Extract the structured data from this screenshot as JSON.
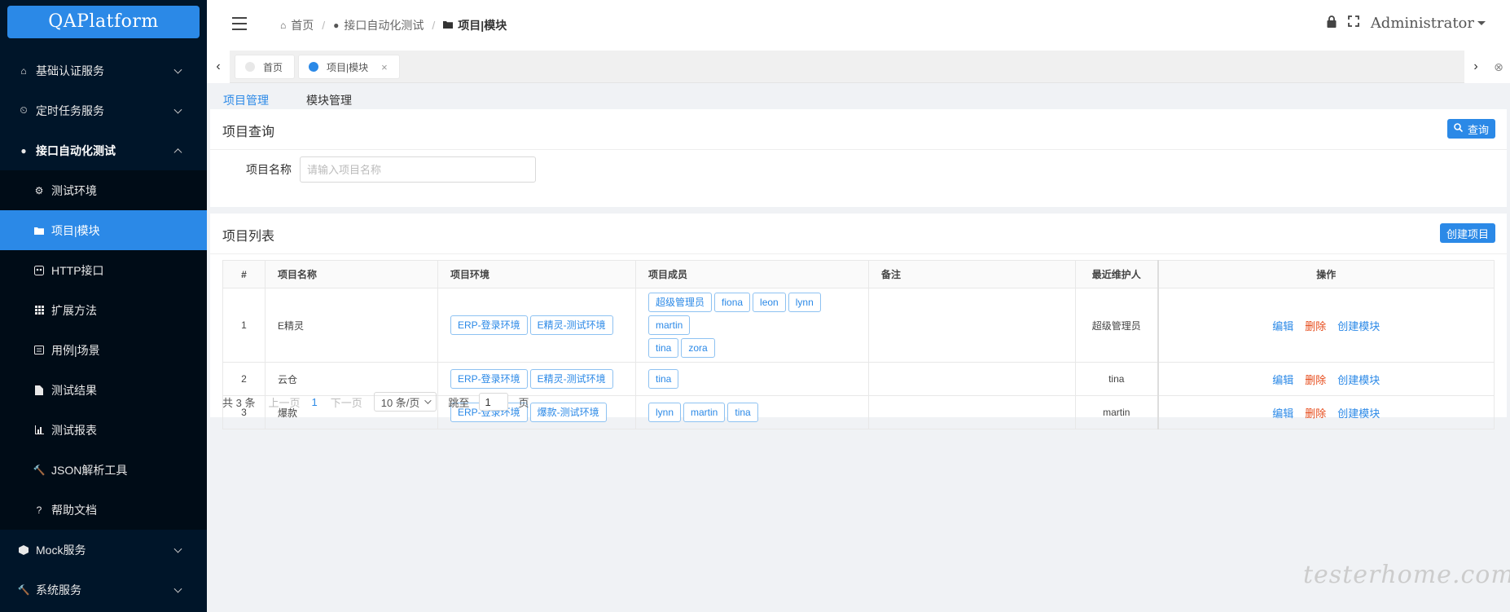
{
  "app": {
    "logo": "QAPlatform"
  },
  "sidebar": {
    "items": [
      {
        "label": "基础认证服务",
        "icon": "home-icon"
      },
      {
        "label": "定时任务服务",
        "icon": "alarm-clock-icon"
      },
      {
        "label": "接口自动化测试",
        "icon": "drop-icon",
        "children": [
          {
            "label": "测试环境",
            "icon": "gear-icon"
          },
          {
            "label": "项目|模块",
            "icon": "folder-icon"
          },
          {
            "label": "HTTP接口",
            "icon": "api-icon"
          },
          {
            "label": "扩展方法",
            "icon": "grid-icon"
          },
          {
            "label": "用例|场景",
            "icon": "case-icon"
          },
          {
            "label": "测试结果",
            "icon": "file-icon"
          },
          {
            "label": "测试报表",
            "icon": "bar-chart-icon"
          },
          {
            "label": "JSON解析工具",
            "icon": "wrench-icon"
          },
          {
            "label": "帮助文档",
            "icon": "question-icon"
          }
        ]
      },
      {
        "label": "Mock服务",
        "icon": "cube-icon"
      },
      {
        "label": "系统服务",
        "icon": "wrench-icon"
      }
    ]
  },
  "header": {
    "breadcrumb": [
      "首页",
      "接口自动化测试",
      "项目|模块"
    ],
    "user": "Administrator"
  },
  "tabs": [
    {
      "label": "首页"
    },
    {
      "label": "项目|模块",
      "close": "×"
    }
  ],
  "subtabs": [
    "项目管理",
    "模块管理"
  ],
  "query": {
    "title": "项目查询",
    "button": "查询",
    "field_label": "项目名称",
    "placeholder": "请输入项目名称"
  },
  "list": {
    "title": "项目列表",
    "create_button": "创建项目",
    "columns": [
      "#",
      "项目名称",
      "项目环境",
      "项目成员",
      "备注",
      "最近维护人",
      "操作"
    ],
    "rows": [
      {
        "index": "1",
        "name": "E精灵",
        "envs": [
          "ERP-登录环境",
          "E精灵-测试环境"
        ],
        "members": [
          "超级管理员",
          "fiona",
          "leon",
          "lynn",
          "martin",
          "tina",
          "zora"
        ],
        "remark": "",
        "maintainer": "超级管理员"
      },
      {
        "index": "2",
        "name": "云仓",
        "envs": [
          "ERP-登录环境",
          "E精灵-测试环境"
        ],
        "members": [
          "tina"
        ],
        "remark": "",
        "maintainer": "tina"
      },
      {
        "index": "3",
        "name": "爆款",
        "envs": [
          "ERP-登录环境",
          "爆款-测试环境"
        ],
        "members": [
          "lynn",
          "martin",
          "tina"
        ],
        "remark": "",
        "maintainer": "martin"
      }
    ],
    "actions": {
      "edit": "编辑",
      "delete": "删除",
      "create_module": "创建模块"
    }
  },
  "pager": {
    "total": "共 3 条",
    "prev": "上一页",
    "current": "1",
    "next": "下一页",
    "page_size": "10 条/页",
    "jump_label": "跳至",
    "jump_value": "1",
    "page_unit": "页"
  },
  "watermark": "testerhome.com",
  "colors": {
    "accent": "#2b89e7",
    "sidebar": "#001529",
    "danger": "#e64a19"
  }
}
